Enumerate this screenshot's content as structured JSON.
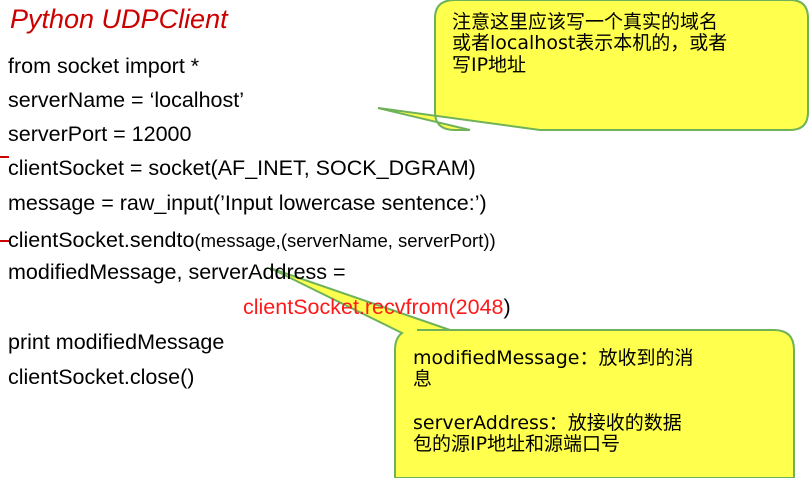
{
  "slide": {
    "title": "Python UDPClient",
    "code": {
      "line1": "from socket import *",
      "line2": "serverName = ‘localhost’",
      "line3": "serverPort = 12000",
      "line4": "clientSocket = socket(AF_INET, SOCK_DGRAM)",
      "line5": "message = raw_input(’Input lowercase sentence:’)",
      "line6_a": "clientSocket.sendto",
      "line6_b": "(message,(serverName, serverPort))",
      "line7": "modifiedMessage, serverAddress =",
      "line8_red": "clientSocket.recvfrom(2048",
      "line8_close": ")",
      "line9": "print modifiedMessage",
      "line10": "clientSocket.close()"
    },
    "callout_top": {
      "line1": "注意这里应该写一个真实的域名",
      "line2": "或者localhost表示本机的，或者",
      "line3": "写IP地址"
    },
    "callout_bottom": {
      "p1_line1": "modifiedMessage：放收到的消",
      "p1_line2": "息",
      "p2_line1": "serverAddress：放接收的数据",
      "p2_line2": "包的源IP地址和源端口号"
    },
    "colors": {
      "title": "#cc0000",
      "highlight": "#ff1a1a",
      "callout_fill": "#ffff4d",
      "callout_border": "#6fb25a"
    }
  }
}
